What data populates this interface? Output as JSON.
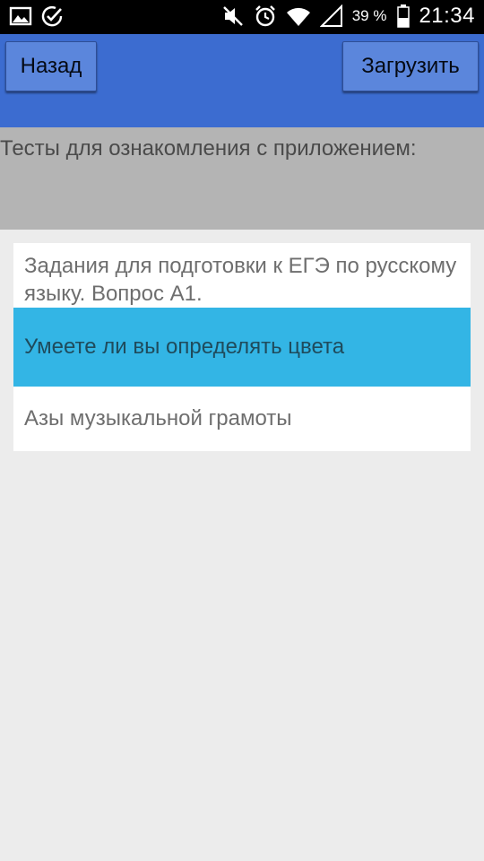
{
  "status_bar": {
    "icons_left": [
      "image-icon",
      "check-circle-icon"
    ],
    "icons_right": [
      "mute-icon",
      "alarm-icon",
      "wifi-icon",
      "signal-icon"
    ],
    "battery_percent": "39 %",
    "time": "21:34"
  },
  "toolbar": {
    "back_label": "Назад",
    "load_label": "Загрузить"
  },
  "header": {
    "title": "Тесты для ознакомления с приложением:"
  },
  "tests": [
    {
      "label": "Задания для подготовки к ЕГЭ по русскому языку. Вопрос А1."
    },
    {
      "label": "Умеете ли вы определять цвета",
      "selected": true
    },
    {
      "label": "Азы музыкальной грамоты"
    }
  ],
  "colors": {
    "toolbar": "#3c6cd0",
    "selected_item": "#33b5e5",
    "header_bg": "#b4b4b4"
  }
}
